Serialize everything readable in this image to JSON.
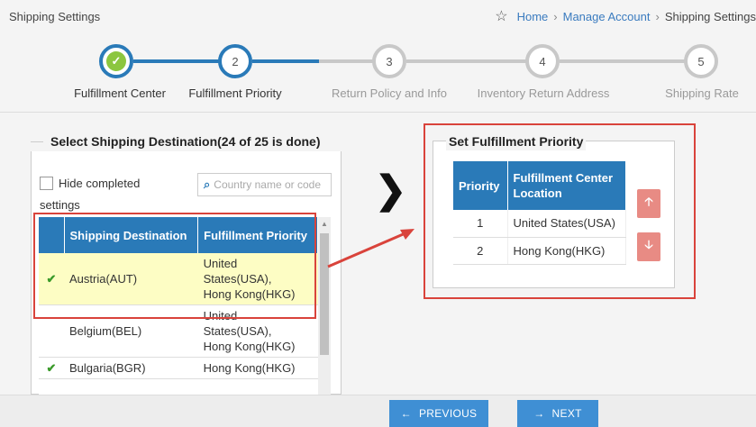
{
  "header": {
    "title": "Shipping Settings",
    "breadcrumb": [
      "Home",
      "Manage Account",
      "Shipping Settings"
    ]
  },
  "stepper": {
    "steps": [
      {
        "number": "",
        "label": "Fulfillment Center",
        "state": "done"
      },
      {
        "number": "2",
        "label": "Fulfillment Priority",
        "state": "active"
      },
      {
        "number": "3",
        "label": "Return Policy and Info",
        "state": "todo"
      },
      {
        "number": "4",
        "label": "Inventory Return Address",
        "state": "todo"
      },
      {
        "number": "5",
        "label": "Shipping Rate",
        "state": "todo"
      }
    ]
  },
  "destinations": {
    "legend": "Select Shipping Destination(24 of 25 is done)",
    "hide_completed_label": "Hide completed",
    "hide_completed_label2": "settings",
    "search_placeholder": "Country name or code",
    "columns": [
      "Shipping Destination",
      "Fulfillment Priority"
    ],
    "rows": [
      {
        "done": "✔",
        "destination": "Austria(AUT)",
        "priority_l1": "United",
        "priority_l2": "States(USA),",
        "priority_l3": "Hong Kong(HKG)"
      },
      {
        "done": "",
        "destination": "Belgium(BEL)",
        "priority_l1": "United",
        "priority_l2": "States(USA),",
        "priority_l3": "Hong Kong(HKG)"
      },
      {
        "done": "✔",
        "destination": "Bulgaria(BGR)",
        "priority_l1": "Hong Kong(HKG)",
        "priority_l2": "",
        "priority_l3": ""
      }
    ]
  },
  "priority": {
    "legend": "Set Fulfillment Priority",
    "col_priority": "Priority",
    "col_location_l1": "Fulfillment Center",
    "col_location_l2": "Location",
    "rows": [
      {
        "priority": "1",
        "location": "United States(USA)"
      },
      {
        "priority": "2",
        "location": "Hong Kong(HKG)"
      }
    ]
  },
  "footer": {
    "previous_label": "PREVIOUS",
    "next_label": "NEXT"
  },
  "colors": {
    "primary": "#2a7ab8",
    "highlight_row": "#fdfdc4",
    "annotation_red": "#d9433b",
    "check_green": "#8cc63f",
    "move_button": "#e88b84"
  }
}
